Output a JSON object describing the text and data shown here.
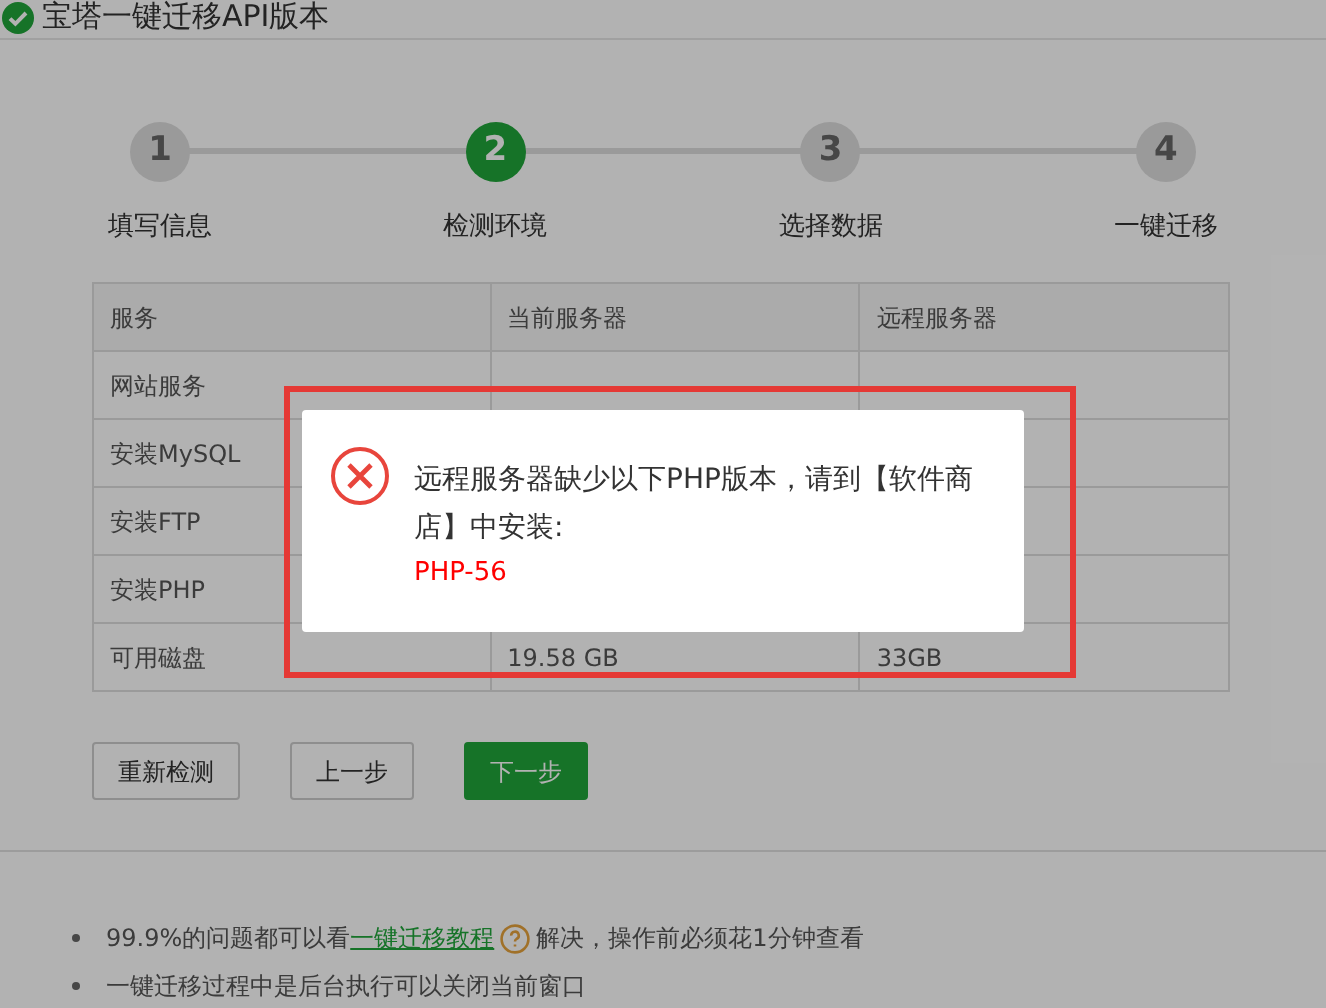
{
  "window": {
    "title": "宝塔一键迁移API版本"
  },
  "steps": [
    {
      "number": "1",
      "label": "填写信息",
      "selected": false
    },
    {
      "number": "2",
      "label": "检测环境",
      "selected": true
    },
    {
      "number": "3",
      "label": "选择数据",
      "selected": false
    },
    {
      "number": "4",
      "label": "一键迁移",
      "selected": false
    }
  ],
  "table": {
    "columns": [
      "服务",
      "当前服务器",
      "远程服务器"
    ],
    "rows": [
      [
        "网站服务",
        "",
        ""
      ],
      [
        "安装MySQL",
        "",
        ""
      ],
      [
        "安装FTP",
        "",
        ""
      ],
      [
        "安装PHP",
        "",
        ""
      ],
      [
        "可用磁盘",
        "19.58 GB",
        "33GB"
      ]
    ]
  },
  "buttons": [
    {
      "label": "重新检测",
      "kind": "default"
    },
    {
      "label": "上一步",
      "kind": "default"
    },
    {
      "label": "下一步",
      "kind": "primary"
    }
  ],
  "notes": [
    {
      "before": "99.9%的问题都可以看",
      "link": "一键迁移教程",
      "after": "解决，操作前必须花1分钟查看"
    },
    {
      "before": "一键迁移过程中是后台执行可以关闭当前窗口"
    }
  ],
  "dialog": {
    "message": "远程服务器缺少以下PHP版本，请到【软件商店】中安装:",
    "missing": "PHP-56"
  }
}
